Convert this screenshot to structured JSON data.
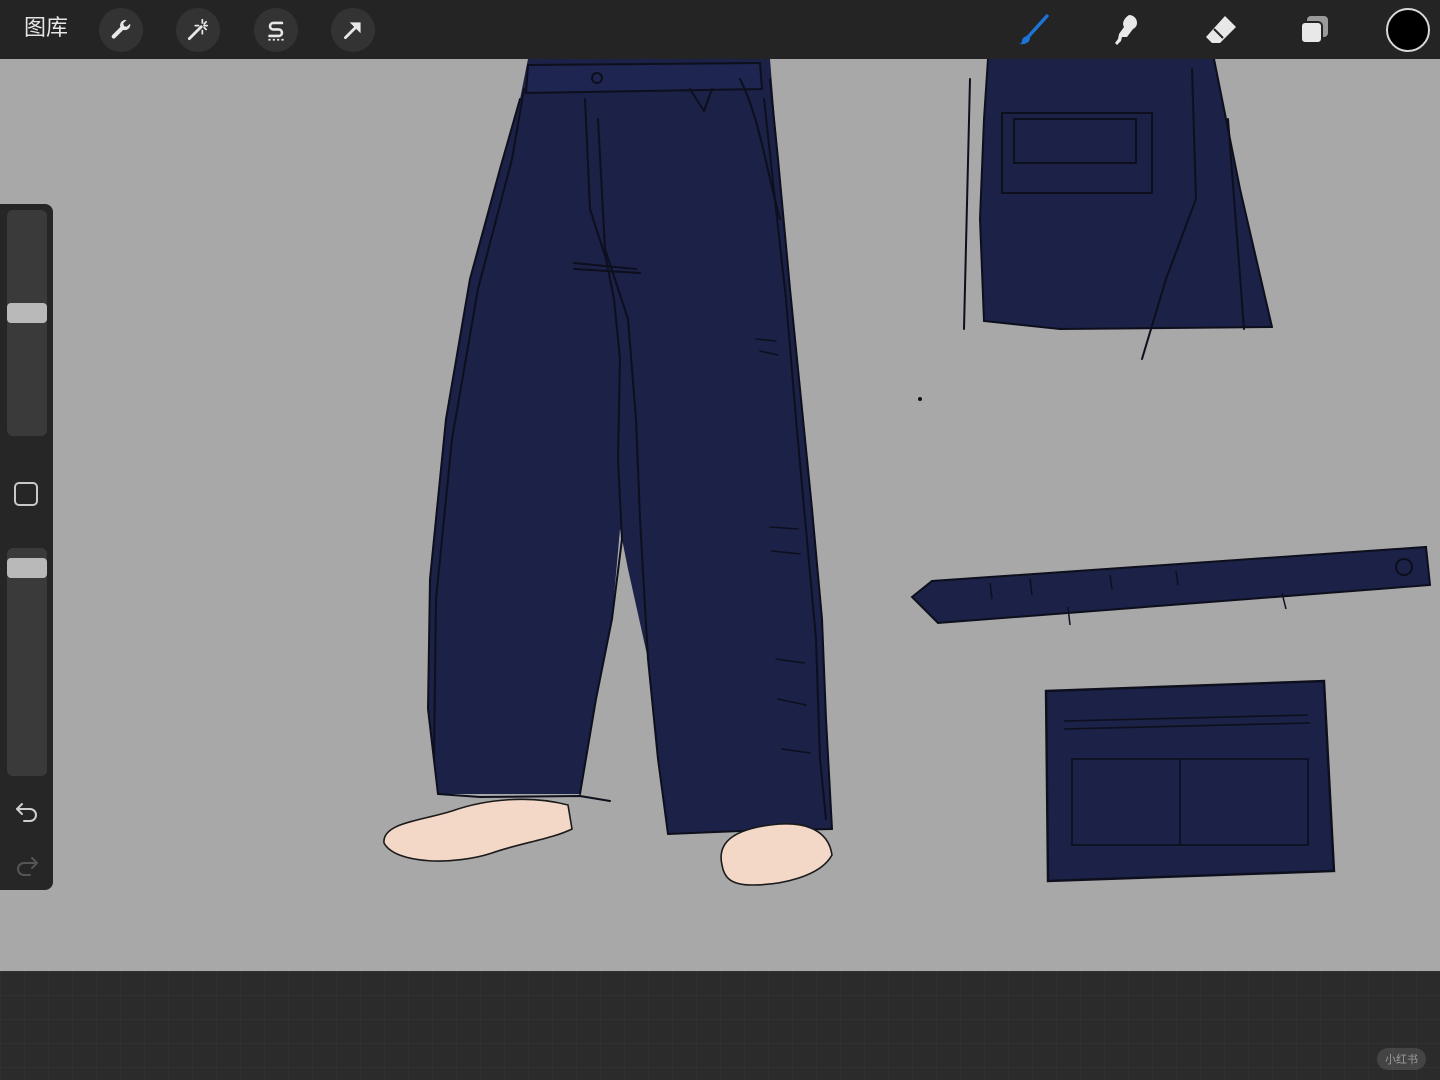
{
  "topbar": {
    "gallery_label": "图库",
    "left_tools": [
      {
        "icon": "wrench-icon",
        "name": "actions"
      },
      {
        "icon": "magic-wand-icon",
        "name": "adjustments"
      },
      {
        "icon": "selection-s-icon",
        "name": "selection"
      },
      {
        "icon": "arrow-cursor-icon",
        "name": "transform"
      }
    ],
    "right_tools": [
      {
        "icon": "brush-icon",
        "name": "brush",
        "active": true
      },
      {
        "icon": "smudge-icon",
        "name": "smudge"
      },
      {
        "icon": "eraser-icon",
        "name": "eraser"
      },
      {
        "icon": "layers-icon",
        "name": "layers"
      }
    ],
    "current_color": "#000000",
    "active_tool_color": "#1e73d6"
  },
  "sidebar": {
    "brush_size_level": 0.55,
    "brush_opacity_level": 0.95,
    "modify_icon": "square-icon",
    "undo_icon": "undo-icon",
    "redo_icon": "redo-icon"
  },
  "canvas": {
    "background_color": "#a8a8a8",
    "ink_color": "#1b2147",
    "skin_color": "#f3d8c8",
    "line_color": "#0d0f1c"
  },
  "watermark": {
    "text": "小红书"
  }
}
